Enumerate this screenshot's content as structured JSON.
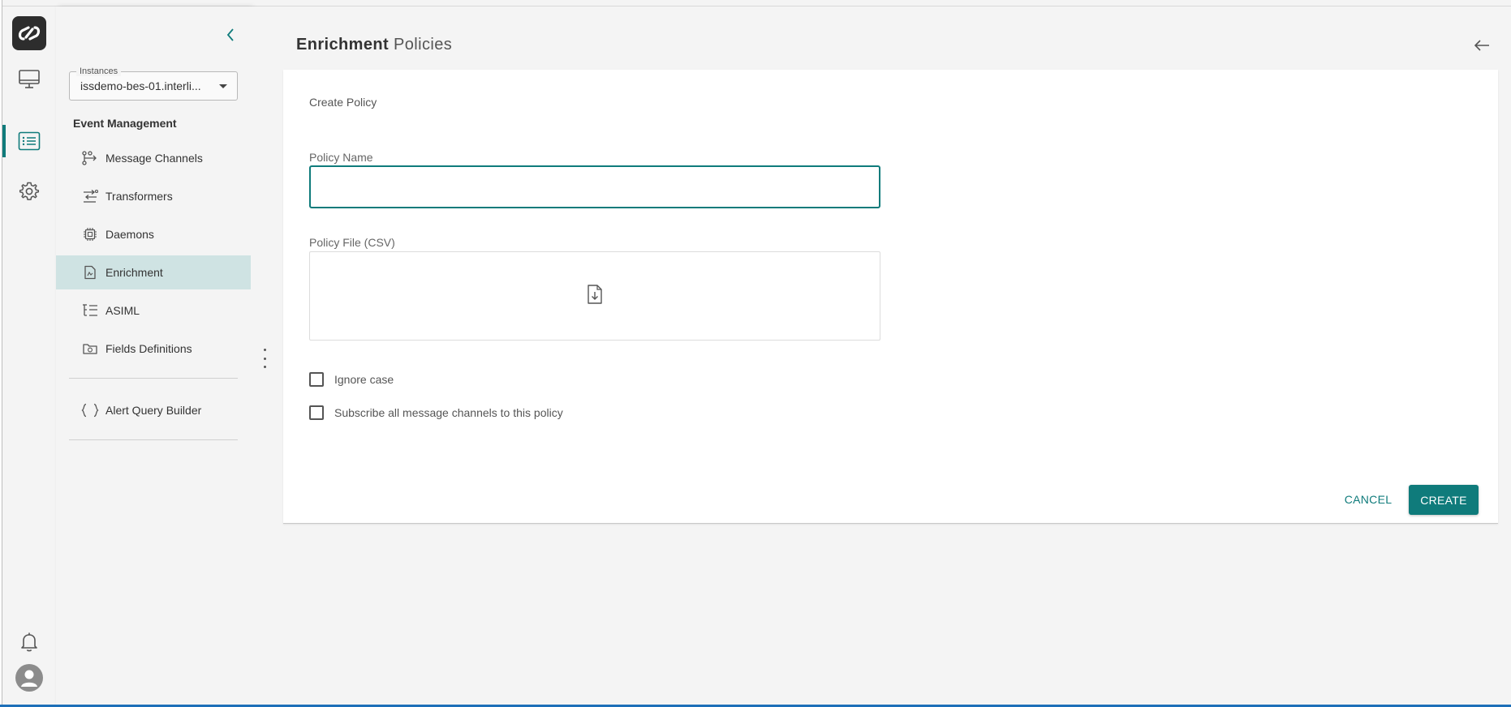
{
  "rail": {
    "items": [
      {
        "icon": "monitor-icon"
      },
      {
        "icon": "list-icon",
        "active": true
      },
      {
        "icon": "gear-icon"
      }
    ],
    "bottom": [
      {
        "icon": "bell-icon"
      },
      {
        "icon": "user-avatar-icon"
      }
    ],
    "accent": "#0f7b7b"
  },
  "sidebar": {
    "instances_label": "Instances",
    "instances_value": "issdemo-bes-01.interli...",
    "section_title": "Event Management",
    "items": [
      {
        "label": "Message Channels",
        "icon": "channels-icon"
      },
      {
        "label": "Transformers",
        "icon": "transformers-icon"
      },
      {
        "label": "Daemons",
        "icon": "chip-icon"
      },
      {
        "label": "Enrichment",
        "icon": "document-icon",
        "active": true
      },
      {
        "label": "ASIML",
        "icon": "tree-list-icon"
      },
      {
        "label": "Fields Definitions",
        "icon": "folder-icon"
      }
    ],
    "extra_items": [
      {
        "label": "Alert Query Builder",
        "icon": "braces-icon"
      }
    ]
  },
  "main": {
    "title_bold": "Enrichment",
    "title_regular": "Policies",
    "card": {
      "title": "Create Policy",
      "policy_name_label": "Policy Name",
      "policy_name_value": "",
      "policy_file_label": "Policy File (CSV)",
      "checkboxes": [
        {
          "label": "Ignore case",
          "checked": false
        },
        {
          "label": "Subscribe all message channels to this policy",
          "checked": false
        }
      ],
      "cancel_label": "CANCEL",
      "create_label": "CREATE"
    }
  }
}
